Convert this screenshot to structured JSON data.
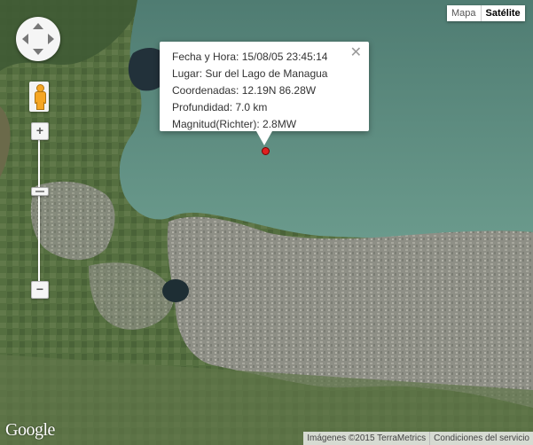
{
  "map_type": {
    "options": [
      "Mapa",
      "Satélite"
    ],
    "selected": "Satélite"
  },
  "info_window": {
    "lines": [
      "Fecha y Hora: 15/08/05 23:45:14",
      "Lugar: Sur del Lago de Managua",
      "Coordenadas: 12.19N 86.28W",
      "Profundidad: 7.0 km",
      "Magnitud(Richter): 2.8MW"
    ],
    "close_symbol": "✕"
  },
  "zoom": {
    "in_label": "+",
    "out_label": "−",
    "level": 0.3
  },
  "logo": "Google",
  "attribution": {
    "imagery": "Imágenes ©2015 TerraMetrics",
    "terms": "Condiciones del servicio"
  },
  "colors": {
    "marker": "#e02020",
    "lake": "#5c8a7e",
    "urban": "#9a9a8e"
  },
  "icons": [
    "pan-control-icon",
    "pegman-icon",
    "close-icon",
    "marker-icon"
  ]
}
